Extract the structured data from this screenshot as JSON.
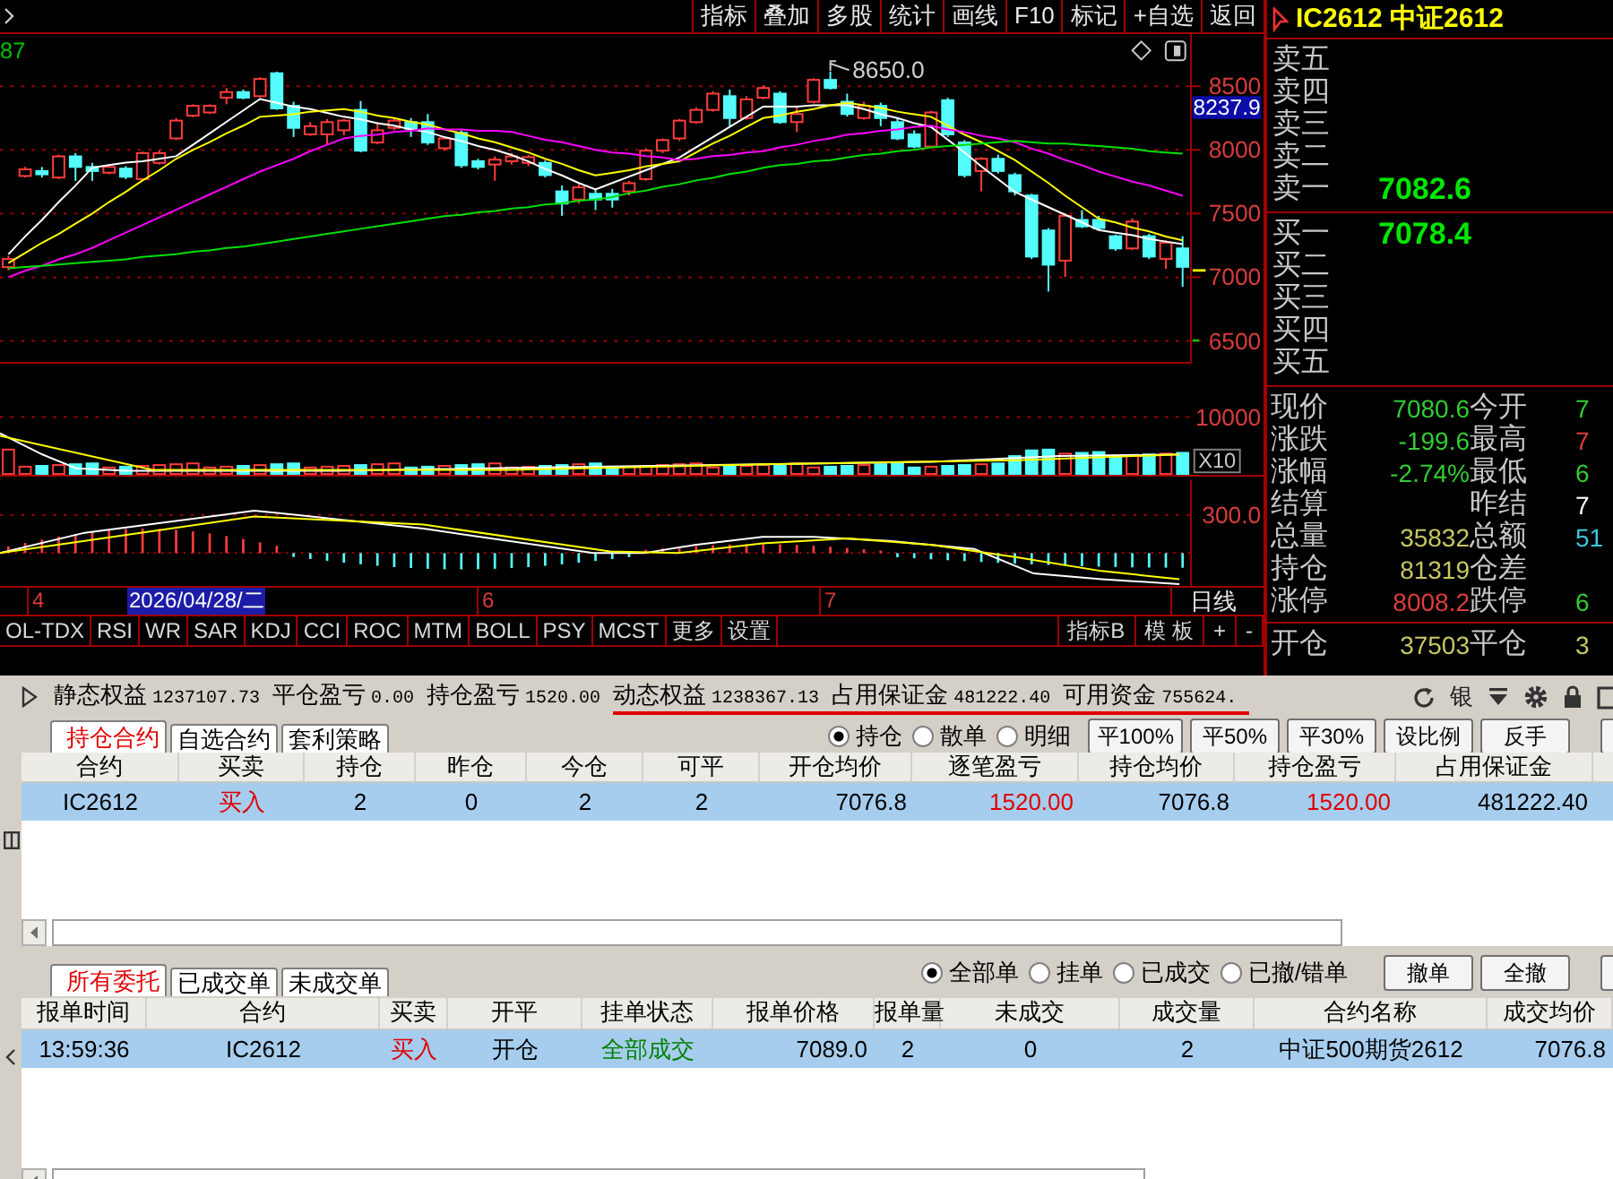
{
  "chart_toolbar": {
    "buttons": [
      "指标",
      "叠加",
      "多股",
      "统计",
      "画线",
      "F10",
      "标记",
      "+自选",
      "返回"
    ]
  },
  "price_chart": {
    "corner_value": "87",
    "cursor_value": "8237.9",
    "peak_label": "8650.0",
    "chart_data": {
      "type": "candlestick",
      "categories": [
        null,
        null,
        null,
        null,
        null,
        null,
        null,
        null,
        null,
        null,
        null,
        null,
        null,
        null,
        null,
        null,
        null,
        null,
        null,
        null,
        null,
        null,
        null,
        null,
        null,
        null,
        null,
        null,
        null,
        null,
        null,
        null,
        null,
        null,
        null,
        null,
        null,
        null,
        null,
        null,
        null,
        null,
        null,
        null,
        null,
        null,
        null,
        null,
        null,
        null,
        null,
        null,
        null,
        null,
        null,
        null,
        null,
        null,
        null,
        null,
        null,
        null,
        null,
        null,
        null,
        null,
        null,
        null,
        null,
        null,
        null
      ],
      "ylim": [
        6320,
        8910
      ],
      "yticks": [
        8500,
        8000,
        7500,
        7000,
        6500
      ],
      "grid": true,
      "ohlc": [
        [
          7079,
          7168,
          7053,
          7143
        ],
        [
          7795,
          7866,
          7783,
          7847
        ],
        [
          7834,
          7866,
          7783,
          7808
        ],
        [
          7783,
          7962,
          7770,
          7949
        ],
        [
          7949,
          7975,
          7757,
          7866
        ],
        [
          7866,
          7898,
          7757,
          7834
        ],
        [
          7821,
          7885,
          7808,
          7866
        ],
        [
          7853,
          7872,
          7770,
          7789
        ],
        [
          7770,
          7987,
          7757,
          7975
        ],
        [
          7898,
          7994,
          7885,
          7975
        ],
        [
          8090,
          8250,
          8077,
          8230
        ],
        [
          8269,
          8358,
          8256,
          8346
        ],
        [
          8294,
          8358,
          8282,
          8346
        ],
        [
          8410,
          8486,
          8358,
          8454
        ],
        [
          8454,
          8474,
          8397,
          8410
        ],
        [
          8422,
          8570,
          8410,
          8557
        ],
        [
          8602,
          8614,
          8314,
          8326
        ],
        [
          8346,
          8378,
          8102,
          8173
        ],
        [
          8122,
          8218,
          8109,
          8186
        ],
        [
          8122,
          8243,
          8039,
          8218
        ],
        [
          8154,
          8243,
          8115,
          8230
        ],
        [
          8314,
          8384,
          7981,
          7994
        ],
        [
          8058,
          8218,
          8045,
          8154
        ],
        [
          8173,
          8243,
          8154,
          8230
        ],
        [
          8218,
          8250,
          8102,
          8166
        ],
        [
          8218,
          8282,
          8039,
          8058
        ],
        [
          8013,
          8102,
          7994,
          8090
        ],
        [
          8134,
          8154,
          7859,
          7879
        ],
        [
          7911,
          7930,
          7847,
          7866
        ],
        [
          7885,
          7949,
          7757,
          7923
        ],
        [
          7911,
          7975,
          7885,
          7949
        ],
        [
          7898,
          7962,
          7872,
          7943
        ],
        [
          7898,
          7917,
          7783,
          7802
        ],
        [
          7674,
          7719,
          7482,
          7578
        ],
        [
          7610,
          7731,
          7578,
          7706
        ],
        [
          7655,
          7693,
          7527,
          7610
        ],
        [
          7655,
          7693,
          7546,
          7610
        ],
        [
          7674,
          7757,
          7642,
          7738
        ],
        [
          7770,
          8013,
          7757,
          7994
        ],
        [
          7994,
          8090,
          7975,
          8077
        ],
        [
          8090,
          8243,
          8070,
          8230
        ],
        [
          8218,
          8333,
          8205,
          8314
        ],
        [
          8314,
          8461,
          8301,
          8442
        ],
        [
          8422,
          8474,
          8186,
          8250
        ],
        [
          8250,
          8422,
          8237,
          8397
        ],
        [
          8410,
          8506,
          8397,
          8486
        ],
        [
          8442,
          8461,
          8205,
          8218
        ],
        [
          8218,
          8346,
          8141,
          8282
        ],
        [
          8378,
          8563,
          8365,
          8550
        ],
        [
          8550,
          8614,
          8474,
          8486
        ],
        [
          8378,
          8442,
          8262,
          8282
        ],
        [
          8250,
          8378,
          8237,
          8346
        ],
        [
          8346,
          8371,
          8186,
          8250
        ],
        [
          8218,
          8250,
          8077,
          8090
        ],
        [
          8122,
          8154,
          8013,
          8026
        ],
        [
          8026,
          8307,
          8013,
          8294
        ],
        [
          8390,
          8410,
          8102,
          8122
        ],
        [
          8058,
          8077,
          7783,
          7802
        ],
        [
          7834,
          7943,
          7674,
          7930
        ],
        [
          7930,
          7962,
          7815,
          7834
        ],
        [
          7802,
          7821,
          7642,
          7674
        ],
        [
          7642,
          7655,
          7143,
          7162
        ],
        [
          7367,
          7386,
          6887,
          7098
        ],
        [
          7130,
          7501,
          7002,
          7482
        ],
        [
          7450,
          7527,
          7386,
          7399
        ],
        [
          7450,
          7482,
          7367,
          7386
        ],
        [
          7322,
          7335,
          7207,
          7226
        ],
        [
          7226,
          7463,
          7213,
          7437
        ],
        [
          7322,
          7341,
          7143,
          7162
        ],
        [
          7143,
          7290,
          7066,
          7271
        ],
        [
          7226,
          7322,
          6925,
          7081
        ]
      ],
      "series": [
        {
          "type": "line",
          "color": "#ffffff",
          "values": [
            7180,
            7320,
            7450,
            7590,
            7720,
            7860,
            7880,
            7900,
            7910,
            7930,
            7950,
            8040,
            8130,
            8220,
            8310,
            8400,
            8370,
            8340,
            8320,
            8290,
            8260,
            8240,
            8210,
            8190,
            8160,
            8140,
            8100,
            8070,
            8030,
            8000,
            7960,
            7910,
            7850,
            7800,
            7740,
            7690,
            7740,
            7790,
            7840,
            7890,
            7940,
            8020,
            8100,
            8180,
            8260,
            8340,
            8340,
            8340,
            8350,
            8350,
            8350,
            8320,
            8280,
            8250,
            8210,
            8180,
            8080,
            7980,
            7870,
            7770,
            7670,
            7610,
            7550,
            7490,
            7430,
            7370,
            7350,
            7330,
            7300,
            7280,
            7260
          ]
        },
        {
          "type": "line",
          "color": "#ffff00",
          "values": [
            7110,
            7190,
            7270,
            7340,
            7420,
            7500,
            7590,
            7670,
            7760,
            7840,
            7930,
            8000,
            8060,
            8130,
            8190,
            8260,
            8270,
            8280,
            8300,
            8310,
            8320,
            8300,
            8270,
            8250,
            8220,
            8200,
            8160,
            8130,
            8090,
            8060,
            8020,
            7980,
            7930,
            7890,
            7840,
            7800,
            7820,
            7840,
            7870,
            7890,
            7910,
            7980,
            8050,
            8110,
            8180,
            8250,
            8270,
            8300,
            8320,
            8350,
            8370,
            8350,
            8330,
            8300,
            8280,
            8260,
            8190,
            8120,
            8060,
            7990,
            7920,
            7830,
            7740,
            7640,
            7550,
            7460,
            7430,
            7390,
            7360,
            7320,
            7290
          ]
        },
        {
          "type": "line",
          "color": "#ff00ff",
          "values": [
            7000,
            7050,
            7090,
            7140,
            7180,
            7230,
            7290,
            7350,
            7410,
            7470,
            7530,
            7590,
            7650,
            7710,
            7770,
            7830,
            7880,
            7930,
            7990,
            8040,
            8090,
            8110,
            8120,
            8140,
            8150,
            8170,
            8160,
            8160,
            8150,
            8150,
            8140,
            8110,
            8080,
            8060,
            8030,
            8000,
            7980,
            7970,
            7950,
            7940,
            7920,
            7930,
            7950,
            7960,
            7980,
            7990,
            8020,
            8040,
            8070,
            8090,
            8120,
            8130,
            8150,
            8160,
            8180,
            8190,
            8160,
            8140,
            8110,
            8090,
            8060,
            8010,
            7970,
            7920,
            7880,
            7830,
            7790,
            7750,
            7720,
            7680,
            7640
          ]
        },
        {
          "type": "line",
          "color": "#00e000",
          "values": [
            7070,
            7080,
            7090,
            7100,
            7110,
            7120,
            7130,
            7140,
            7160,
            7170,
            7180,
            7200,
            7210,
            7230,
            7240,
            7260,
            7280,
            7300,
            7320,
            7340,
            7360,
            7380,
            7400,
            7420,
            7440,
            7460,
            7480,
            7490,
            7510,
            7520,
            7540,
            7550,
            7570,
            7580,
            7600,
            7610,
            7630,
            7660,
            7680,
            7710,
            7730,
            7760,
            7780,
            7810,
            7830,
            7860,
            7880,
            7890,
            7910,
            7920,
            7940,
            7960,
            7970,
            7990,
            8000,
            8020,
            8030,
            8040,
            8050,
            8060,
            8070,
            8060,
            8050,
            8050,
            8040,
            8030,
            8020,
            8010,
            7990,
            7980,
            7970
          ]
        }
      ]
    }
  },
  "volume_chart": {
    "axis_labels": [
      "10000"
    ],
    "scale": "X10"
  },
  "indicator_chart": {
    "axis_labels": [
      "300.0"
    ]
  },
  "date_axis": {
    "labels": [
      {
        "kind": "tick",
        "text": "4"
      },
      {
        "kind": "cursor",
        "text": "2026/04/28/二"
      },
      {
        "kind": "tick",
        "text": "6"
      },
      {
        "kind": "tick",
        "text": "7"
      }
    ],
    "period": "日线"
  },
  "indicator_tabs": {
    "items": [
      {
        "label": "OL-TDX",
        "selected": false
      },
      {
        "label": "RSI",
        "selected": false
      },
      {
        "label": "WR",
        "selected": false
      },
      {
        "label": "SAR",
        "selected": false
      },
      {
        "label": "KDJ",
        "selected": false
      },
      {
        "label": "CCI",
        "selected": false
      },
      {
        "label": "ROC",
        "selected": false
      },
      {
        "label": "MTM",
        "selected": false
      },
      {
        "label": "BOLL",
        "selected": false
      },
      {
        "label": "PSY",
        "selected": false
      },
      {
        "label": "MCST",
        "selected": false
      },
      {
        "label": "更多",
        "selected": false
      },
      {
        "label": "设置",
        "selected": false
      }
    ],
    "right_items": [
      "指标B",
      "模 板",
      "+",
      "-"
    ]
  },
  "quote": {
    "title": "IC2612 中证2612",
    "asks": [
      {
        "label": "卖五"
      },
      {
        "label": "卖四"
      },
      {
        "label": "卖三"
      },
      {
        "label": "卖二"
      },
      {
        "label": "卖一",
        "price": "7082.6"
      }
    ],
    "bids": [
      {
        "label": "买一",
        "price": "7078.4"
      },
      {
        "label": "买二"
      },
      {
        "label": "买三"
      },
      {
        "label": "买四"
      },
      {
        "label": "买五"
      }
    ],
    "stats": [
      {
        "label": "现价",
        "value": "7080.6",
        "color": "#33cc33"
      },
      {
        "label": "今开",
        "value": "7",
        "color": "#33cc33"
      },
      {
        "label": "涨跌",
        "value": "-199.6",
        "color": "#33cc33"
      },
      {
        "label": "最高",
        "value": "7",
        "color": "#e03c3c"
      },
      {
        "label": "涨幅",
        "value": "-2.74%",
        "color": "#33cc33"
      },
      {
        "label": "最低",
        "value": "6",
        "color": "#33cc33"
      },
      {
        "label": "结算"
      },
      {
        "label": "昨结",
        "value": "7",
        "color": "#ffffff"
      },
      {
        "label": "总量",
        "value": "35832",
        "color": "#c8c864"
      },
      {
        "label": "总额",
        "value": "51",
        "color": "#3cc8dc"
      },
      {
        "label": "持仓",
        "value": "81319",
        "color": "#c8c864"
      },
      {
        "label": "仓差"
      },
      {
        "label": "涨停",
        "value": "8008.2",
        "color": "#e03c3c"
      },
      {
        "label": "跌停",
        "value": "6",
        "color": "#33cc33"
      }
    ],
    "volume_split": [
      {
        "label": "开仓",
        "value": "37503",
        "color": "#c8c864"
      },
      {
        "label": "平仓",
        "value": "3",
        "color": "#c8c864"
      }
    ]
  },
  "account": {
    "fields": [
      {
        "label": "静态权益",
        "value": "1237107.73",
        "underlined": false
      },
      {
        "label": "平仓盈亏",
        "value": "0.00",
        "underlined": false
      },
      {
        "label": "持仓盈亏",
        "value": "1520.00",
        "underlined": false
      },
      {
        "label": "动态权益",
        "value": "1238367.13",
        "underlined": true
      },
      {
        "label": "占用保证金",
        "value": "481222.40",
        "underlined": true
      },
      {
        "label": "可用资金",
        "value": "755624.",
        "underlined": true
      }
    ],
    "bank_label": "银"
  },
  "positions": {
    "tabs": [
      {
        "label": "持仓合约",
        "selected": true
      },
      {
        "label": "自选合约",
        "selected": false
      },
      {
        "label": "套利策略",
        "selected": false
      }
    ],
    "filters": [
      {
        "label": "持仓",
        "selected": true
      },
      {
        "label": "散单",
        "selected": false
      },
      {
        "label": "明细",
        "selected": false
      }
    ],
    "buttons": [
      "平100%",
      "平50%",
      "平30%",
      "设比例",
      "反手"
    ],
    "overflow_button": true,
    "table": {
      "columns": [
        "合约",
        "买卖",
        "持仓",
        "昨仓",
        "今仓",
        "可平",
        "开仓均价",
        "逐笔盈亏",
        "持仓均价",
        "持仓盈亏",
        "占用保证金"
      ],
      "rows": [
        {
          "selected": true,
          "cells": [
            {
              "text": "IC2612"
            },
            {
              "text": "买入",
              "color": "#e00000"
            },
            {
              "text": "2"
            },
            {
              "text": "0"
            },
            {
              "text": "2"
            },
            {
              "text": "2"
            },
            {
              "text": "7076.8"
            },
            {
              "text": "1520.00",
              "color": "#e00000"
            },
            {
              "text": "7076.8"
            },
            {
              "text": "1520.00",
              "color": "#e00000"
            },
            {
              "text": "481222.40"
            }
          ]
        }
      ]
    }
  },
  "orders": {
    "tabs": [
      {
        "label": "所有委托",
        "selected": true
      },
      {
        "label": "已成交单",
        "selected": false
      },
      {
        "label": "未成交单",
        "selected": false
      }
    ],
    "filters": [
      {
        "label": "全部单",
        "selected": true
      },
      {
        "label": "挂单",
        "selected": false
      },
      {
        "label": "已成交",
        "selected": false
      },
      {
        "label": "已撤/错单",
        "selected": false
      }
    ],
    "buttons": [
      "撤单",
      "全撤"
    ],
    "overflow_button": true,
    "table": {
      "columns": [
        "报单时间",
        "合约",
        "买卖",
        "开平",
        "挂单状态",
        "报单价格",
        "报单量",
        "未成交",
        "成交量",
        "合约名称",
        "成交均价"
      ],
      "rows": [
        {
          "selected": true,
          "cells": [
            {
              "text": "13:59:36"
            },
            {
              "text": "IC2612"
            },
            {
              "text": "买入",
              "color": "#e00000"
            },
            {
              "text": "开仓"
            },
            {
              "text": "全部成交",
              "color": "#008000"
            },
            {
              "text": "7089.0"
            },
            {
              "text": "2"
            },
            {
              "text": "0"
            },
            {
              "text": "2"
            },
            {
              "text": "中证500期货2612"
            },
            {
              "text": "7076.8"
            }
          ]
        }
      ]
    }
  }
}
